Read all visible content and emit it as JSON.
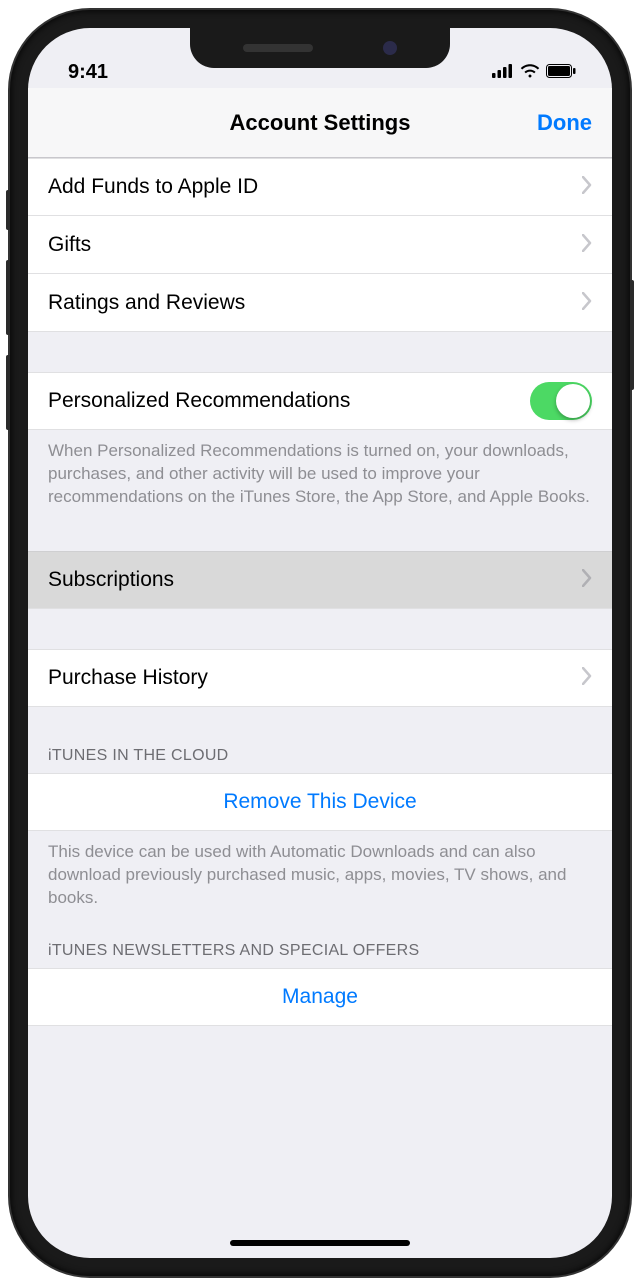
{
  "status": {
    "time": "9:41"
  },
  "nav": {
    "title": "Account Settings",
    "done": "Done"
  },
  "cells": {
    "addFunds": "Add Funds to Apple ID",
    "gifts": "Gifts",
    "ratings": "Ratings and Reviews",
    "personalized": "Personalized Recommendations",
    "subscriptions": "Subscriptions",
    "purchaseHistory": "Purchase History",
    "removeDevice": "Remove This Device",
    "manage": "Manage"
  },
  "footers": {
    "personalized": "When Personalized Recommendations is turned on, your downloads, purchases, and other activity will be used to improve your recommendations on the iTunes Store, the App Store, and Apple Books.",
    "icloud": "This device can be used with Automatic Downloads and can also download previously purchased music, apps, movies, TV shows, and books."
  },
  "headers": {
    "icloud": "iTUNES IN THE CLOUD",
    "newsletters": "iTUNES NEWSLETTERS AND SPECIAL OFFERS"
  },
  "toggles": {
    "personalized": true
  }
}
